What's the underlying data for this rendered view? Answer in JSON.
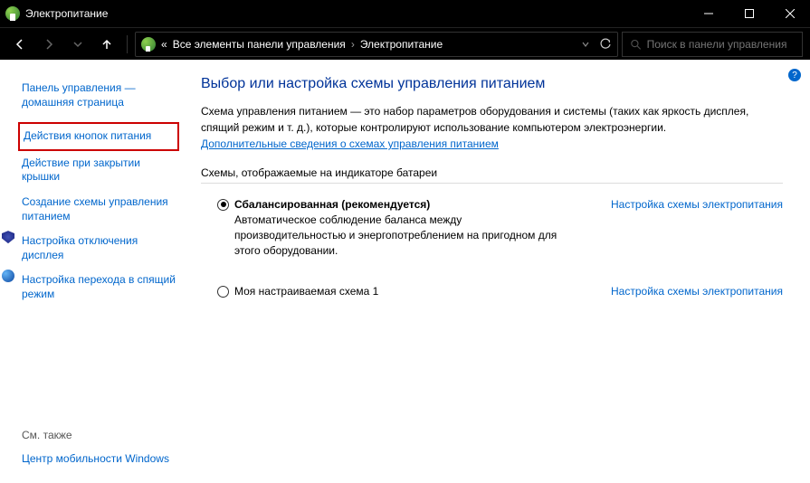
{
  "window": {
    "title": "Электропитание"
  },
  "breadcrumb": {
    "prefix": "«",
    "parent": "Все элементы панели управления",
    "current": "Электропитание"
  },
  "search": {
    "placeholder": "Поиск в панели управления"
  },
  "sidebar": {
    "home": "Панель управления — домашняя страница",
    "links": [
      "Действия кнопок питания",
      "Действие при закрытии крышки",
      "Создание схемы управления питанием",
      "Настройка отключения дисплея",
      "Настройка перехода в спящий режим"
    ],
    "see_also_label": "См. также",
    "see_also_link": "Центр мобильности Windows"
  },
  "main": {
    "heading": "Выбор или настройка схемы управления питанием",
    "description": "Схема управления питанием — это набор параметров оборудования и системы (таких как яркость дисплея, спящий режим и т. д.), которые контролируют использование компьютером электроэнергии.",
    "more_link": "Дополнительные сведения о схемах управления питанием",
    "schemes_header": "Схемы, отображаемые на индикаторе батареи",
    "schemes": [
      {
        "name": "Сбалансированная (рекомендуется)",
        "desc": "Автоматическое соблюдение баланса между производительностью и энергопотреблением на пригодном для этого оборудовании.",
        "selected": true,
        "settings_link": "Настройка схемы электропитания"
      },
      {
        "name": "Моя настраиваемая схема 1",
        "desc": "",
        "selected": false,
        "settings_link": "Настройка схемы электропитания"
      }
    ]
  }
}
